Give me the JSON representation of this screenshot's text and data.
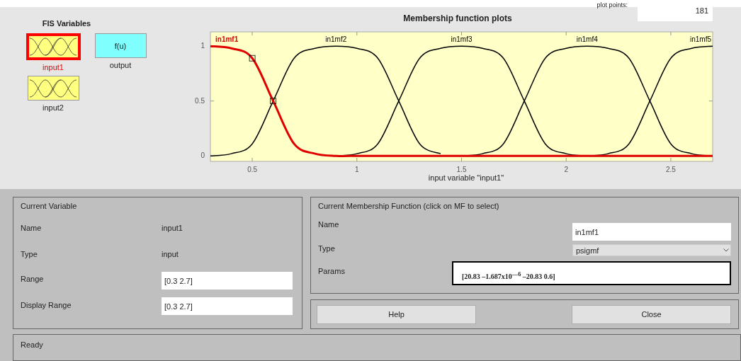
{
  "plot_points": {
    "label": "plot points:",
    "value": "181"
  },
  "fis_variables": {
    "title": "FIS Variables",
    "items": [
      {
        "name": "input1",
        "kind": "input",
        "selected": true
      },
      {
        "name": "output",
        "kind": "output",
        "symbol": "f(u)",
        "selected": false
      },
      {
        "name": "input2",
        "kind": "input",
        "selected": false
      }
    ]
  },
  "plot": {
    "title": "Membership function plots",
    "curves": [
      {
        "selected": true
      },
      {
        "selected": false
      },
      {
        "selected": false
      },
      {
        "selected": false
      },
      {
        "selected": false
      }
    ],
    "chart_data": {
      "type": "line",
      "xlabel": "input variable \"input1\"",
      "x": [
        0.3,
        0.4,
        0.5,
        0.6,
        0.7,
        0.8,
        0.9,
        1.0,
        1.1,
        1.2,
        1.3,
        1.4,
        1.5,
        1.6,
        1.7,
        1.8,
        1.9,
        2.0,
        2.1,
        2.2,
        2.3,
        2.4,
        2.5,
        2.6,
        2.7
      ],
      "xlim": [
        0.3,
        2.7
      ],
      "ylim": [
        -0.05,
        1.13
      ],
      "xticks": [
        0.5,
        1,
        1.5,
        2,
        2.5
      ],
      "yticks": [
        0,
        0.5,
        1
      ],
      "series": [
        {
          "name": "in1mf1",
          "color": "#e00000",
          "values": [
            1,
            0.98,
            0.89,
            0.5,
            0.11,
            0.02,
            0,
            0,
            0,
            0,
            0,
            0,
            0,
            0,
            0,
            0,
            0,
            0,
            0,
            0,
            0,
            0,
            0,
            0,
            0
          ]
        },
        {
          "name": "in1mf2",
          "color": "#000000",
          "values": [
            0,
            0.02,
            0.11,
            0.5,
            0.89,
            0.98,
            1,
            0.98,
            0.89,
            0.5,
            0.11,
            0.02,
            null,
            null,
            null,
            null,
            null,
            null,
            null,
            null,
            null,
            null,
            null,
            null,
            null
          ]
        },
        {
          "name": "in1mf3",
          "color": "#000000",
          "values": [
            null,
            null,
            null,
            null,
            null,
            null,
            0,
            0.02,
            0.11,
            0.5,
            0.89,
            0.98,
            1,
            0.98,
            0.89,
            0.5,
            0.11,
            0.02,
            0,
            null,
            null,
            null,
            null,
            null,
            null
          ]
        },
        {
          "name": "in1mf4",
          "color": "#000000",
          "values": [
            null,
            null,
            null,
            null,
            null,
            null,
            null,
            null,
            null,
            null,
            null,
            null,
            0,
            0.02,
            0.11,
            0.5,
            0.89,
            0.98,
            1,
            0.98,
            0.89,
            0.5,
            0.11,
            0.02,
            0
          ]
        },
        {
          "name": "in1mf5",
          "color": "#000000",
          "values": [
            null,
            null,
            null,
            null,
            null,
            null,
            null,
            null,
            null,
            null,
            null,
            null,
            null,
            null,
            null,
            null,
            null,
            null,
            0,
            0.02,
            0.11,
            0.5,
            0.89,
            0.98,
            1
          ]
        }
      ]
    }
  },
  "current_variable": {
    "title": "Current Variable",
    "name_label": "Name",
    "name": "input1",
    "type_label": "Type",
    "type": "input",
    "range_label": "Range",
    "range": "[0.3 2.7]",
    "display_range_label": "Display Range",
    "display_range": "[0.3 2.7]"
  },
  "current_mf": {
    "title": "Current Membership Function (click on MF to select)",
    "name_label": "Name",
    "name": "in1mf1",
    "type_label": "Type",
    "type": "psigmf",
    "params_label": "Params",
    "params": "[20.83 –1.687x10$^{—6}$ –20.83 0.6]"
  },
  "buttons": [
    "Help",
    "Close"
  ],
  "status": "Ready"
}
